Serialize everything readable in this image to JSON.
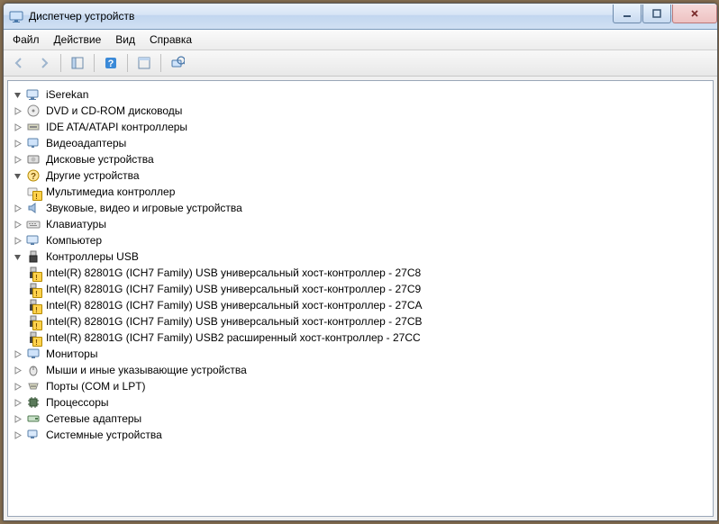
{
  "window": {
    "title": "Диспетчер устройств"
  },
  "menu": {
    "file": "Файл",
    "action": "Действие",
    "view": "Вид",
    "help": "Справка"
  },
  "tree": {
    "root": "iSerekan",
    "dvd": "DVD и CD-ROM дисководы",
    "ide": "IDE ATA/ATAPI контроллеры",
    "video": "Видеоадаптеры",
    "disk": "Дисковые устройства",
    "other": "Другие устройства",
    "other_children": {
      "multimedia": "Мультимедиа контроллер"
    },
    "sound": "Звуковые, видео и игровые устройства",
    "keyboard": "Клавиатуры",
    "computer": "Компьютер",
    "usb": "Контроллеры USB",
    "usb_children": {
      "c8": "Intel(R) 82801G (ICH7 Family) USB универсальный хост-контроллер  - 27C8",
      "c9": "Intel(R) 82801G (ICH7 Family) USB универсальный хост-контроллер  - 27C9",
      "ca": "Intel(R) 82801G (ICH7 Family) USB универсальный хост-контроллер  - 27CA",
      "cb": "Intel(R) 82801G (ICH7 Family) USB универсальный хост-контроллер  - 27CB",
      "cc": "Intel(R) 82801G (ICH7 Family) USB2 расширенный хост-контроллер  - 27CC"
    },
    "monitor": "Мониторы",
    "mouse": "Мыши и иные указывающие устройства",
    "ports": "Порты (COM и LPT)",
    "cpu": "Процессоры",
    "network": "Сетевые адаптеры",
    "system": "Системные устройства"
  }
}
